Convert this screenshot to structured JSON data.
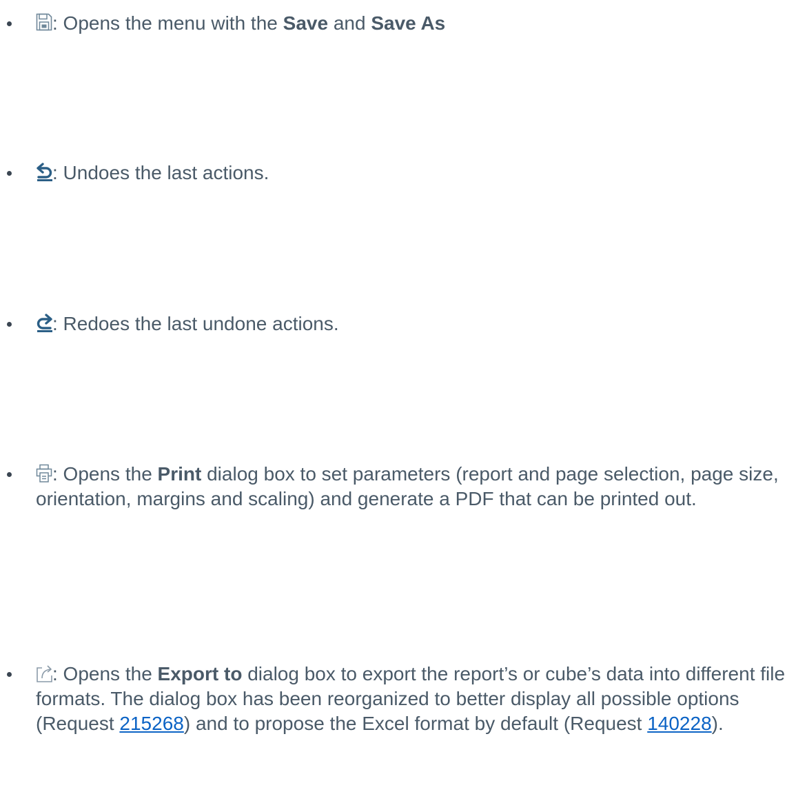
{
  "colors": {
    "text": "#4a5a68",
    "bold": "#3b4652",
    "link": "#0b63c5",
    "icon_dark": "#2b5f86",
    "icon_light": "#6f8799"
  },
  "items": [
    {
      "icon": "save-icon",
      "sep": ":",
      "t1": " Opens the menu with the ",
      "b1": "Save",
      "t2": " and ",
      "b2": "Save As"
    },
    {
      "icon": "undo-icon",
      "sep": ":",
      "t1": " Undoes the last actions."
    },
    {
      "icon": "redo-icon",
      "sep": ":",
      "t1": " Redoes the last undone actions."
    },
    {
      "icon": "print-icon",
      "sep": ":",
      "t1": " Opens the ",
      "b1": "Print",
      "t2": " dialog box to set parameters (report and page selection, page size, orientation, margins and scaling) and generate a PDF that can be printed out."
    },
    {
      "icon": "export-icon",
      "sep": ":",
      "t1": " Opens the ",
      "b1": "Export to",
      "t2": " dialog box to export the report’s or cube’s data into different file formats. The dialog box has been reorganized to better display all possible options (Request ",
      "link1": "215268",
      "t3": ") and to propose the Excel format by default (Request ",
      "link2": "140228",
      "t4": ")."
    }
  ]
}
